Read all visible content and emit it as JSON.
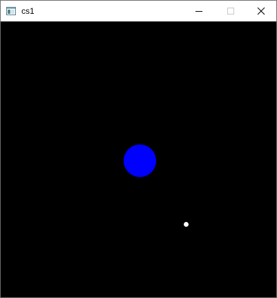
{
  "window": {
    "title": "cs1",
    "app_icon": "app-window-icon",
    "controls": {
      "minimize_icon": "minimize-icon",
      "maximize_icon": "maximize-icon",
      "close_icon": "close-icon"
    }
  },
  "canvas": {
    "background": "#000000",
    "objects": [
      {
        "name": "blue-circle",
        "color": "#0000ff"
      },
      {
        "name": "white-dot",
        "color": "#ffffff"
      }
    ]
  }
}
